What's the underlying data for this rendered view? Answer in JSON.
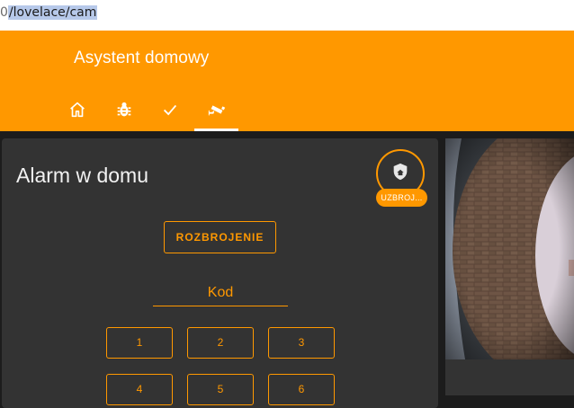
{
  "browser": {
    "url_prefix": "0",
    "url_selected": "/lovelace/cam"
  },
  "header": {
    "title": "Asystent domowy",
    "tabs": [
      {
        "icon": "home-icon",
        "active": false
      },
      {
        "icon": "bug-icon",
        "active": false
      },
      {
        "icon": "check-icon",
        "active": false
      },
      {
        "icon": "cctv-icon",
        "active": true
      }
    ],
    "colors": {
      "primary": "#ff9800",
      "card": "#333333",
      "background": "#1c1c1c"
    }
  },
  "alarm_panel": {
    "title": "Alarm w domu",
    "state_icon": "shield-home-icon",
    "state_badge": "UZBROJ...",
    "disarm_label": "ROZBROJENIE",
    "code_label": "Kod",
    "keys": [
      "1",
      "2",
      "3",
      "4",
      "5",
      "6"
    ]
  },
  "camera_card": {
    "image": "doorbell-camera-view"
  }
}
